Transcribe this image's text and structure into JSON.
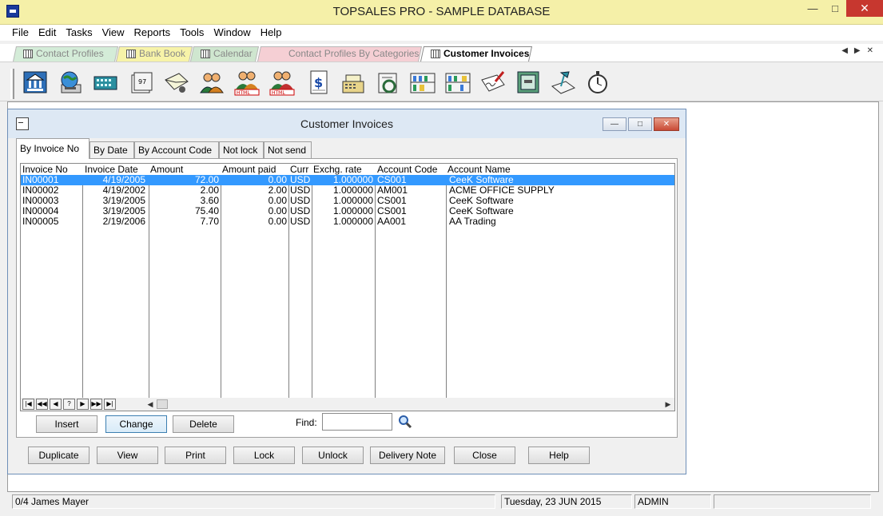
{
  "window": {
    "title": "TOPSALES PRO - SAMPLE DATABASE",
    "minimize": "—",
    "maximize": "□",
    "close": "✕"
  },
  "menu": [
    "File",
    "Edit",
    "Tasks",
    "View",
    "Reports",
    "Tools",
    "Window",
    "Help"
  ],
  "doc_tabs": [
    {
      "label": "Contact Profiles",
      "color": "#d4ecd8"
    },
    {
      "label": "Bank Book",
      "color": "#f7f3a8"
    },
    {
      "label": "Calendar",
      "color": "#cfe6cf"
    },
    {
      "label": "Contact Profiles By Categories",
      "color": "#f5cfd4"
    },
    {
      "label": "Customer Invoices",
      "color": "#ffffff"
    }
  ],
  "tab_nav": {
    "prev": "◀",
    "next": "▶",
    "close": "✕"
  },
  "toolbar_icons": [
    "bank-icon",
    "globe-computer-icon",
    "calculator-icon",
    "calendar-icon",
    "envelope-icon",
    "contacts-icon",
    "contacts-html-icon",
    "contacts-html-alt-icon",
    "dollar-document-icon",
    "cash-register-icon",
    "scanner-icon",
    "shelves-icon",
    "shelves-alt-icon",
    "signature-icon",
    "safe-icon",
    "desk-lamp-icon",
    "stopwatch-icon"
  ],
  "child": {
    "title": "Customer Invoices",
    "tabs": [
      "By Invoice No",
      "By Date",
      "By Account Code",
      "Not lock",
      "Not send"
    ],
    "columns": [
      "Invoice No",
      "Invoice Date",
      "Amount",
      "Amount paid",
      "Curr",
      "Exchg. rate",
      "Account Code",
      "Account Name"
    ],
    "rows": [
      [
        "IN00001",
        "4/19/2005",
        "72.00",
        "0.00",
        "USD",
        "1.000000",
        "CS001",
        "CeeK Software"
      ],
      [
        "IN00002",
        "4/19/2002",
        "2.00",
        "2.00",
        "USD",
        "1.000000",
        "AM001",
        "ACME OFFICE SUPPLY"
      ],
      [
        "IN00003",
        "3/19/2005",
        "3.60",
        "0.00",
        "USD",
        "1.000000",
        "CS001",
        "CeeK Software"
      ],
      [
        "IN00004",
        "3/19/2005",
        "75.40",
        "0.00",
        "USD",
        "1.000000",
        "CS001",
        "CeeK Software"
      ],
      [
        "IN00005",
        "2/19/2006",
        "7.70",
        "0.00",
        "USD",
        "1.000000",
        "AA001",
        "AA Trading"
      ]
    ],
    "nav_buttons": [
      "|◀",
      "◀◀",
      "◀",
      "?",
      "▶",
      "▶▶",
      "▶|"
    ],
    "buttons_row1": [
      "Insert",
      "Change",
      "Delete"
    ],
    "find_label": "Find:",
    "find_value": "",
    "buttons_row2": [
      "Duplicate",
      "View",
      "Print",
      "Lock",
      "Unlock",
      "Delivery Note",
      "Close",
      "Help"
    ]
  },
  "status": {
    "record": "0/4",
    "user": "James Mayer",
    "date": "Tuesday, 23 JUN 2015",
    "role": "ADMIN"
  },
  "colors": {
    "titlebar": "#f5f0a8",
    "selection": "#3399ff",
    "close": "#c7372f"
  }
}
